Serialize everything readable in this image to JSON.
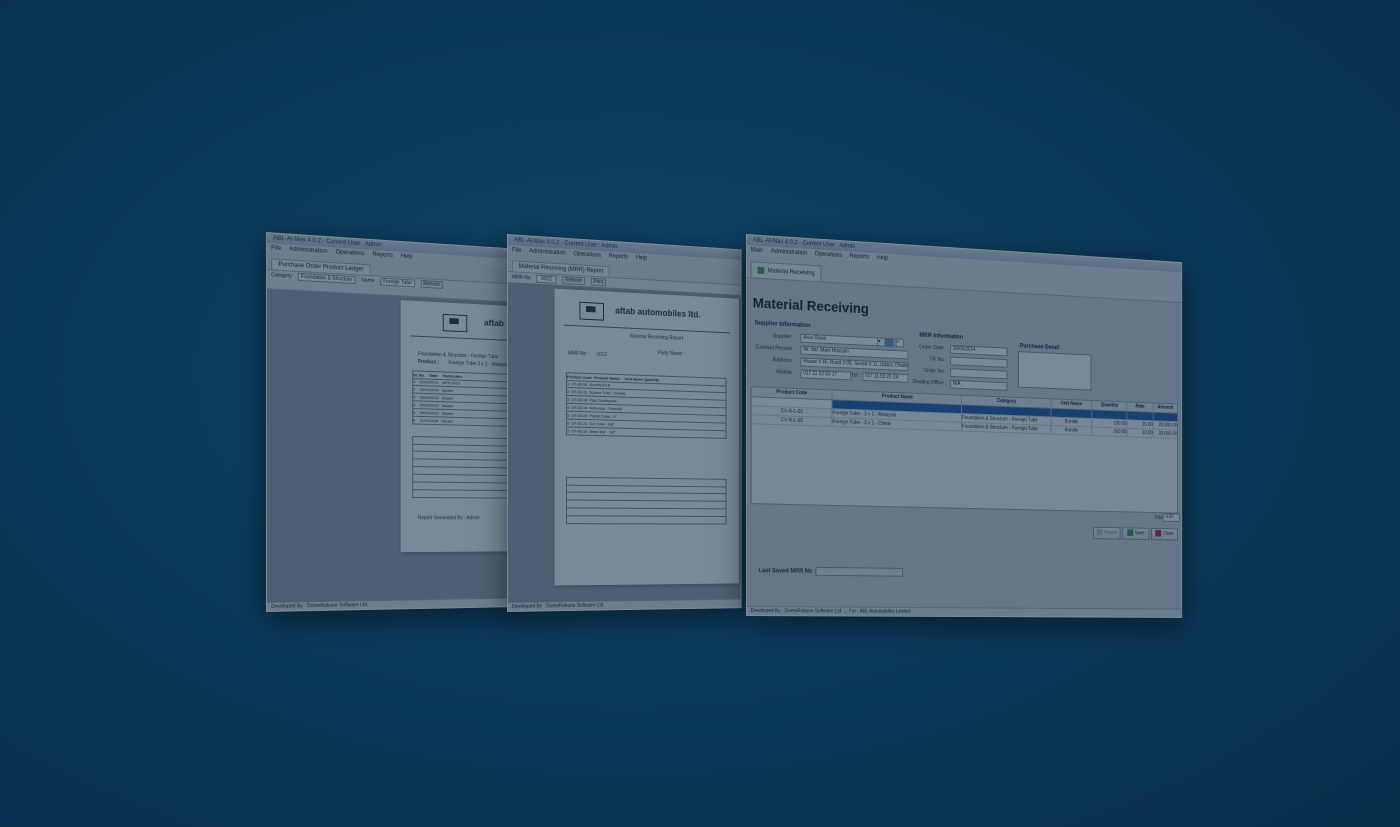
{
  "left_window": {
    "menu": [
      "File",
      "Administration",
      "Operations",
      "Reports",
      "Help"
    ],
    "tab_label": "Purchase Order Product Ledger",
    "toolbar": [
      "Category",
      "Foundation & Structure",
      "Name",
      "Foreign Tube",
      "Refresh"
    ],
    "report": {
      "brand": "aftab",
      "heading1": "Foundation & Structure - Foreign Tube",
      "heading2": "Product :",
      "heading2_value": "Foreign Tube 3 x 1 - Malaysia",
      "col1": "Sl. No.",
      "col2": "Date",
      "col3": "Particulars",
      "rows": [
        [
          "1",
          "01/03/2014",
          "MRR 0012"
        ],
        [
          "2",
          "03/03/2014",
          "Issued"
        ],
        [
          "3",
          "05/03/2014",
          "Issued"
        ],
        [
          "4",
          "07/03/2014",
          "Issued"
        ],
        [
          "5",
          "09/03/2014",
          "Issued"
        ],
        [
          "6",
          "11/03/2014",
          "Issued"
        ]
      ],
      "footer": "Report Generated By : Admin"
    },
    "status": "Developed By : DomeRokune Software Ltd."
  },
  "middle_window": {
    "menu": [
      "File",
      "Administration",
      "Operations",
      "Reports",
      "Help"
    ],
    "tab_label": "Material Receiving (MRR) Report",
    "toolbar": [
      "MRR No",
      "0012",
      "Refresh",
      "Print"
    ],
    "report": {
      "company": "aftab automobiles ltd.",
      "title": "Material Receiving Report",
      "mrr_no_label": "MRR No :",
      "mrr_no": "0012",
      "supplier_label": "Party Name :",
      "col_code": "Product Code",
      "col_name": "Product Name",
      "col_unit": "Unit Name",
      "col_qty": "Quantity",
      "rows": [
        [
          "1",
          "CF-02-04",
          "Gravity Ex-6"
        ],
        [
          "2",
          "CF-02-11",
          "Square Tube - Details"
        ],
        [
          "3",
          "CF-02-18",
          "Pipe Dastiayank"
        ],
        [
          "4",
          "CF-02-19",
          "Adhesive - Formula"
        ],
        [
          "5",
          "CF-02-20",
          "Plastic Tube - 4\""
        ],
        [
          "6",
          "CF-02-21",
          "Gel Tube - 3/4\""
        ],
        [
          "7",
          "CF-02-24",
          "Mesh Bar - 1/4\""
        ]
      ]
    },
    "status": "Developed By : DomeRokune Software Ltd."
  },
  "main_window": {
    "title": "ABL-Al-Mas 4.0.2 - Current User : Admin",
    "menu": [
      "Main",
      "Administration",
      "Operations",
      "Reports",
      "Help"
    ],
    "tab_label": "Material Receiving",
    "form_title": "Material Receiving",
    "supplier_group": "Supplier Information",
    "supplier_label": "Supplier :",
    "supplier_value": "Arun Rana",
    "contact_label": "Contact Person :",
    "contact_value": "Mr. Md. Mani Hossain",
    "address_label": "Address :",
    "address_value": "House # 45, Road # 05, Sector # 11, Uttara, Dhaka",
    "mobile_label": "Mobile :",
    "mobile_value": "017 11 22 53 17",
    "tel_label": "Tel :",
    "tel_value": "017 11 53 21 24",
    "mrr_group": "MRR Information",
    "order_date_label": "Order Date :",
    "order_date_value": "20/05/2014",
    "tr_label": "TR No :",
    "order_no_label": "Order No :",
    "dealing_label": "Dealing Office :",
    "dealing_value": "N/A",
    "purchase_group": "Purchase Detail",
    "grid_headers": [
      "Product Code",
      "Product Name",
      "Category",
      "Unit Name",
      "Quantity",
      "Rate",
      "Amount"
    ],
    "grid_rows": [
      [
        "",
        "",
        "",
        "",
        "",
        "",
        ""
      ],
      [
        "CV-R-L-01",
        "Foreign Tube - 3 x 1 - Malaysia",
        "Foundation & Structure - Foreign Tube",
        "Bundle",
        "100.00",
        "20.00",
        "20,000.00"
      ],
      [
        "CV-R-L-02",
        "Foreign Tube - 3 x 1 - China",
        "Foundation & Structure - Foreign Tube",
        "Bundle",
        "200.00",
        "10.00",
        "20,000.00"
      ]
    ],
    "total_label": "Total",
    "total_value": "0.00",
    "btn_report": "Report",
    "btn_save": "Save",
    "btn_close": "Close",
    "last_saved_label": "Last Saved MRR No :",
    "status": "Developed By : DomeRokune Software Ltd. ... For : ABL Automobiles Limited"
  }
}
